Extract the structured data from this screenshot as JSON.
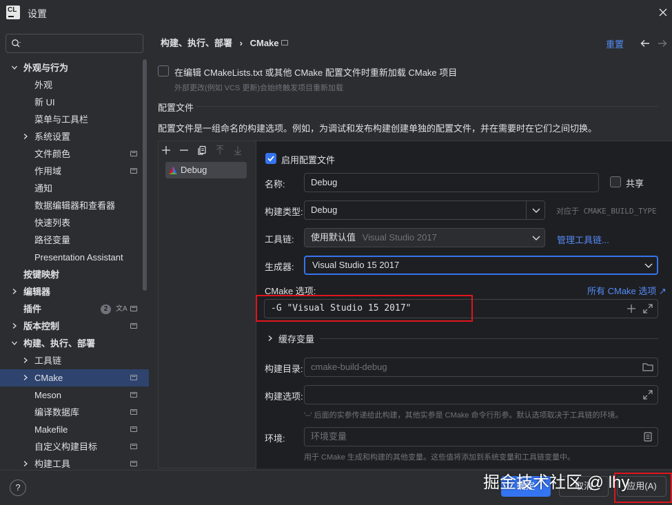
{
  "app": {
    "icon_text": "CL",
    "window_title": "设置"
  },
  "search": {
    "placeholder": ""
  },
  "sidebar": {
    "items": [
      {
        "label": "外观与行为",
        "bold": true,
        "chevron": "down"
      },
      {
        "label": "外观"
      },
      {
        "label": "新 UI"
      },
      {
        "label": "菜单与工具栏"
      },
      {
        "label": "系统设置",
        "chevron": "right"
      },
      {
        "label": "文件颜色",
        "project": true
      },
      {
        "label": "作用域",
        "project": true
      },
      {
        "label": "通知"
      },
      {
        "label": "数据编辑器和查看器"
      },
      {
        "label": "快速列表"
      },
      {
        "label": "路径变量"
      },
      {
        "label": "Presentation Assistant"
      },
      {
        "label": "按键映射",
        "bold": true
      },
      {
        "label": "编辑器",
        "bold": true,
        "chevron": "right"
      },
      {
        "label": "插件",
        "bold": true,
        "badge": "2",
        "lang": true,
        "project": true
      },
      {
        "label": "版本控制",
        "bold": true,
        "chevron": "right",
        "project": true
      },
      {
        "label": "构建、执行、部署",
        "bold": true,
        "chevron": "down"
      },
      {
        "label": "工具链",
        "chevron": "right"
      },
      {
        "label": "CMake",
        "chevron": "right",
        "project": true,
        "selected": true
      },
      {
        "label": "Meson",
        "project": true
      },
      {
        "label": "编译数据库",
        "project": true
      },
      {
        "label": "Makefile",
        "project": true
      },
      {
        "label": "自定义构建目标",
        "project": true
      },
      {
        "label": "构建工具",
        "chevron": "right",
        "project": true
      }
    ]
  },
  "header": {
    "breadcrumb_parent": "构建、执行、部署",
    "breadcrumb_sep": "›",
    "breadcrumb_current": "CMake",
    "reset_label": "重置"
  },
  "reload": {
    "label": "在编辑 CMakeLists.txt 或其他 CMake 配置文件时重新加载 CMake 项目",
    "hint": "外部更改(例如 VCS 更新)会始终触发项目重新加载",
    "checked": false
  },
  "profiles": {
    "heading": "配置文件",
    "description": "配置文件是一组命名的构建选项。例如，为调试和发布构建创建单独的配置文件，并在需要时在它们之间切换。",
    "list": [
      {
        "name": "Debug",
        "icon": "cmake-icon"
      }
    ]
  },
  "detail": {
    "enable_label": "启用配置文件",
    "enable_checked": true,
    "name_label": "名称:",
    "name_value": "Debug",
    "share_label": "共享",
    "share_checked": false,
    "build_type_label": "构建类型:",
    "build_type_value": "Debug",
    "build_type_hint": "对应于 CMAKE_BUILD_TYPE",
    "toolchain_label": "工具链:",
    "toolchain_value": "使用默认值",
    "toolchain_hint": "Visual Studio 2017",
    "manage_toolchains": "管理工具链...",
    "generator_label": "生成器:",
    "generator_value": "Visual Studio 15 2017",
    "cmake_options_label": "CMake 选项:",
    "all_options_link": "所有 CMake 选项 ↗",
    "cmake_options_value": "-G \"Visual Studio 15 2017\"",
    "cache_vars_label": "缓存变量",
    "build_dir_label": "构建目录:",
    "build_dir_placeholder": "cmake-build-debug",
    "build_options_label": "构建选项:",
    "build_options_value": "",
    "build_options_hint": "'--' 后面的实参传递给此构建，其他实参是 CMake 命令行形参。默认选项取决于工具链的环境。",
    "env_label": "环境:",
    "env_placeholder": "环境变量",
    "env_hint": "用于 CMake 生成和构建的其他变量。这些值将添加到系统变量和工具链变量中。"
  },
  "footer": {
    "help": "?",
    "ok_label": "确定",
    "cancel_label": "取消",
    "apply_label": "应用(A)"
  },
  "watermark": "掘金技术社区 @ lhy",
  "colors": {
    "background": "#2b2d30",
    "panel": "#1e1f22",
    "accent": "#3574f0",
    "link": "#548af7",
    "selection": "#2e436e",
    "highlight_box": "#e0141e"
  }
}
